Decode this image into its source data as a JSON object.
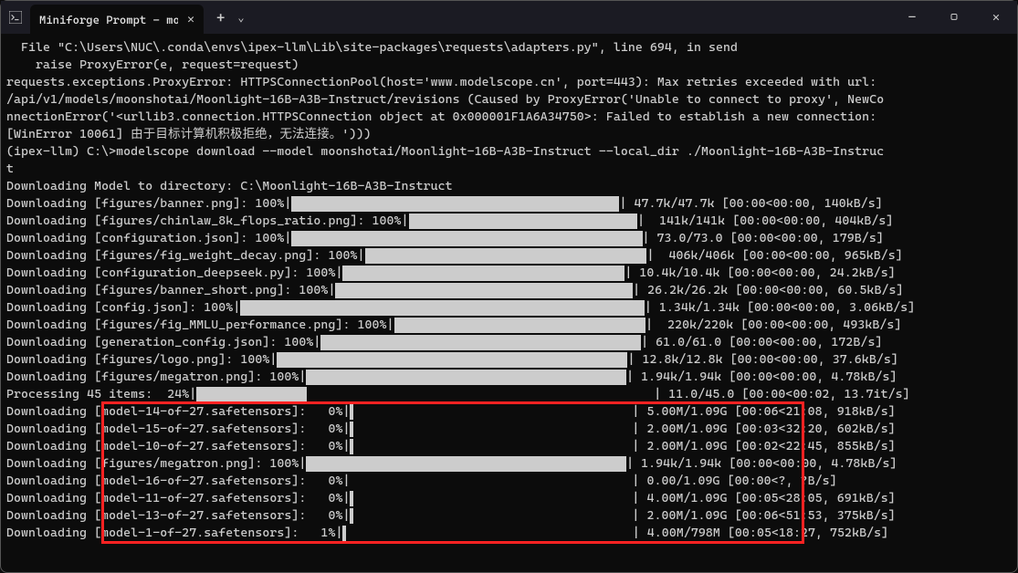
{
  "titlebar": {
    "tab_title": "Miniforge Prompt - modelscop",
    "add_label": "+",
    "dropdown_label": "⌄",
    "min": "—",
    "max": "▢",
    "close": "✕"
  },
  "error_lines": [
    "  File \"C:\\Users\\NUC\\.conda\\envs\\ipex-llm\\Lib\\site-packages\\requests\\adapters.py\", line 694, in send",
    "    raise ProxyError(e, request=request)",
    "requests.exceptions.ProxyError: HTTPSConnectionPool(host='www.modelscope.cn', port=443): Max retries exceeded with url:",
    "/api/v1/models/moonshotai/Moonlight-16B-A3B-Instruct/revisions (Caused by ProxyError('Unable to connect to proxy', NewCo",
    "nnectionError('<urllib3.connection.HTTPSConnection object at 0x000001F1A6A34750>: Failed to establish a new connection:",
    "[WinError 10061] 由于目标计算机积极拒绝，无法连接。')))"
  ],
  "prompt_lines": [
    "",
    "(ipex-llm) C:\\>modelscope download --model moonshotai/Moonlight-16B-A3B-Instruct --local_dir ./Moonlight-16B-A3B-Instruc",
    "t",
    "Downloading Model to directory: C:\\Moonlight-16B-A3B-Instruct"
  ],
  "downloads": [
    {
      "label": "Downloading [figures/banner.png]: 100%",
      "pct": 100,
      "bar_total": 43,
      "stats": "| 47.7k/47.7k [00:00<00:00, 140kB/s]"
    },
    {
      "label": "Downloading [figures/chinlaw_8k_flops_ratio.png]: 100%",
      "pct": 100,
      "bar_total": 30,
      "stats": "|  141k/141k [00:00<00:00, 404kB/s]"
    },
    {
      "label": "Downloading [configuration.json]: 100%",
      "pct": 100,
      "bar_total": 46,
      "stats": "| 73.0/73.0 [00:00<00:00, 179B/s]"
    },
    {
      "label": "Downloading [figures/fig_weight_decay.png]: 100%",
      "pct": 100,
      "bar_total": 37,
      "stats": "|  406k/406k [00:00<00:00, 965kB/s]"
    },
    {
      "label": "Downloading [configuration_deepseek.py]: 100%",
      "pct": 100,
      "bar_total": 37,
      "stats": "| 10.4k/10.4k [00:00<00:00, 24.2kB/s]"
    },
    {
      "label": "Downloading [figures/banner_short.png]: 100%",
      "pct": 100,
      "bar_total": 39,
      "stats": "| 26.2k/26.2k [00:00<00:00, 60.5kB/s]"
    },
    {
      "label": "Downloading [config.json]: 100%",
      "pct": 100,
      "bar_total": 53,
      "stats": "| 1.34k/1.34k [00:00<00:00, 3.06kB/s]"
    },
    {
      "label": "Downloading [figures/fig_MMLU_performance.png]: 100%",
      "pct": 100,
      "bar_total": 33,
      "stats": "|  220k/220k [00:00<00:00, 493kB/s]"
    },
    {
      "label": "Downloading [generation_config.json]: 100%",
      "pct": 100,
      "bar_total": 42,
      "stats": "| 61.0/61.0 [00:00<00:00, 172B/s]"
    },
    {
      "label": "Downloading [figures/logo.png]: 100%",
      "pct": 100,
      "bar_total": 46,
      "stats": "| 12.8k/12.8k [00:00<00:00, 37.6kB/s]"
    },
    {
      "label": "Downloading [figures/megatron.png]: 100%",
      "pct": 100,
      "bar_total": 42,
      "stats": "| 1.94k/1.94k [00:00<00:00, 4.78kB/s]"
    },
    {
      "label": "Processing 45 items:  24%",
      "pct": 24,
      "bar_total": 60,
      "stats": "| 11.0/45.0 [00:00<00:02, 13.7it/s]"
    },
    {
      "label": "Downloading [model-14-of-27.safetensors]:   0%",
      "pct": 1,
      "bar_total": 37,
      "stats": "| 5.00M/1.09G [00:06<21:08, 918kB/s]"
    },
    {
      "label": "Downloading [model-15-of-27.safetensors]:   0%",
      "pct": 1,
      "bar_total": 37,
      "stats": "| 2.00M/1.09G [00:03<32:20, 602kB/s]"
    },
    {
      "label": "Downloading [model-10-of-27.safetensors]:   0%",
      "pct": 1,
      "bar_total": 37,
      "stats": "| 2.00M/1.09G [00:02<22:45, 855kB/s]"
    },
    {
      "label": "Downloading [figures/megatron.png]: 100%",
      "pct": 100,
      "bar_total": 42,
      "stats": "| 1.94k/1.94k [00:00<00:00, 4.78kB/s]"
    },
    {
      "label": "Downloading [model-16-of-27.safetensors]:   0%",
      "pct": 0,
      "bar_total": 37,
      "stats": "| 0.00/1.09G [00:00<?, ?B/s]"
    },
    {
      "label": "Downloading [model-11-of-27.safetensors]:   0%",
      "pct": 1,
      "bar_total": 37,
      "stats": "| 4.00M/1.09G [00:05<28:05, 691kB/s]"
    },
    {
      "label": "Downloading [model-13-of-27.safetensors]:   0%",
      "pct": 1,
      "bar_total": 37,
      "stats": "| 2.00M/1.09G [00:06<51:53, 375kB/s]"
    },
    {
      "label": "Downloading [model-1-of-27.safetensors]:   1%",
      "pct": 1,
      "bar_total": 38,
      "stats": "| 4.00M/798M [00:05<18:27, 752kB/s]"
    }
  ],
  "highlight": {
    "top_row": 12,
    "bottom_row": 19
  }
}
